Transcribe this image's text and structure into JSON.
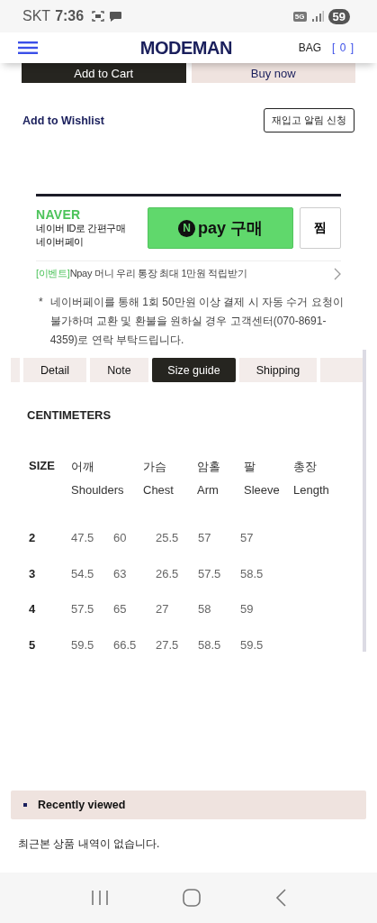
{
  "status_bar": {
    "carrier": "SKT",
    "time": "7:36",
    "network": "5G",
    "battery": "59"
  },
  "header": {
    "logo": "MODEMAN",
    "bag": "BAG",
    "bag_count": "[ 0 ]"
  },
  "buttons": [
    {
      "label": "Add to Cart",
      "kind": "primary"
    },
    {
      "label": "Buy now",
      "kind": "secondary"
    }
  ],
  "wishlist": "Add to Wishlist",
  "restock_button": "재입고 알림 신청",
  "naver_pay": {
    "brand": "NAVER",
    "line1": "네이버 ID로 간편구매",
    "line2": "네이버페이",
    "badge": "N",
    "pay_label": "pay 구매",
    "zzim": "찜",
    "event_tag": "[이벤트]",
    "event_text": "Npay 머니 우리 통장 최대 1만원 적립받기"
  },
  "notice": {
    "mark": "*",
    "text": "네이버페이를 통해 1회 50만원 이상 결제 시 자동 수거 요청이 불가하며 교환 및 환불을 원하실 경우 고객센터(070-8691-4359)로 연락 부탁드립니다."
  },
  "tabs": [
    {
      "label": "Detail",
      "selected": false
    },
    {
      "label": "Note",
      "selected": false
    },
    {
      "label": "Size guide",
      "selected": true
    },
    {
      "label": "Shipping",
      "selected": false
    }
  ],
  "size_table": {
    "unit": "CENTIMETERS",
    "size_heading": "SIZE",
    "columns": [
      {
        "ko": "어깨",
        "en": "Shoulders"
      },
      {
        "ko": "가슴",
        "en": "Chest"
      },
      {
        "ko": "암홀",
        "en": "Arm"
      },
      {
        "ko": "팔",
        "en": "Sleeve"
      },
      {
        "ko": "총장",
        "en": "Length"
      }
    ],
    "rows": [
      {
        "size": "2",
        "values": [
          "47.5",
          "60",
          "25.5",
          "57",
          "57"
        ]
      },
      {
        "size": "3",
        "values": [
          "54.5",
          "63",
          "26.5",
          "57.5",
          "58.5"
        ]
      },
      {
        "size": "4",
        "values": [
          "57.5",
          "65",
          "27",
          "58",
          "59"
        ]
      },
      {
        "size": "5",
        "values": [
          "59.5",
          "66.5",
          "27.5",
          "58.5",
          "59.5"
        ]
      }
    ]
  },
  "recently_viewed": {
    "title": "Recently viewed",
    "empty_message": "최근본 상품 내역이 없습니다."
  }
}
